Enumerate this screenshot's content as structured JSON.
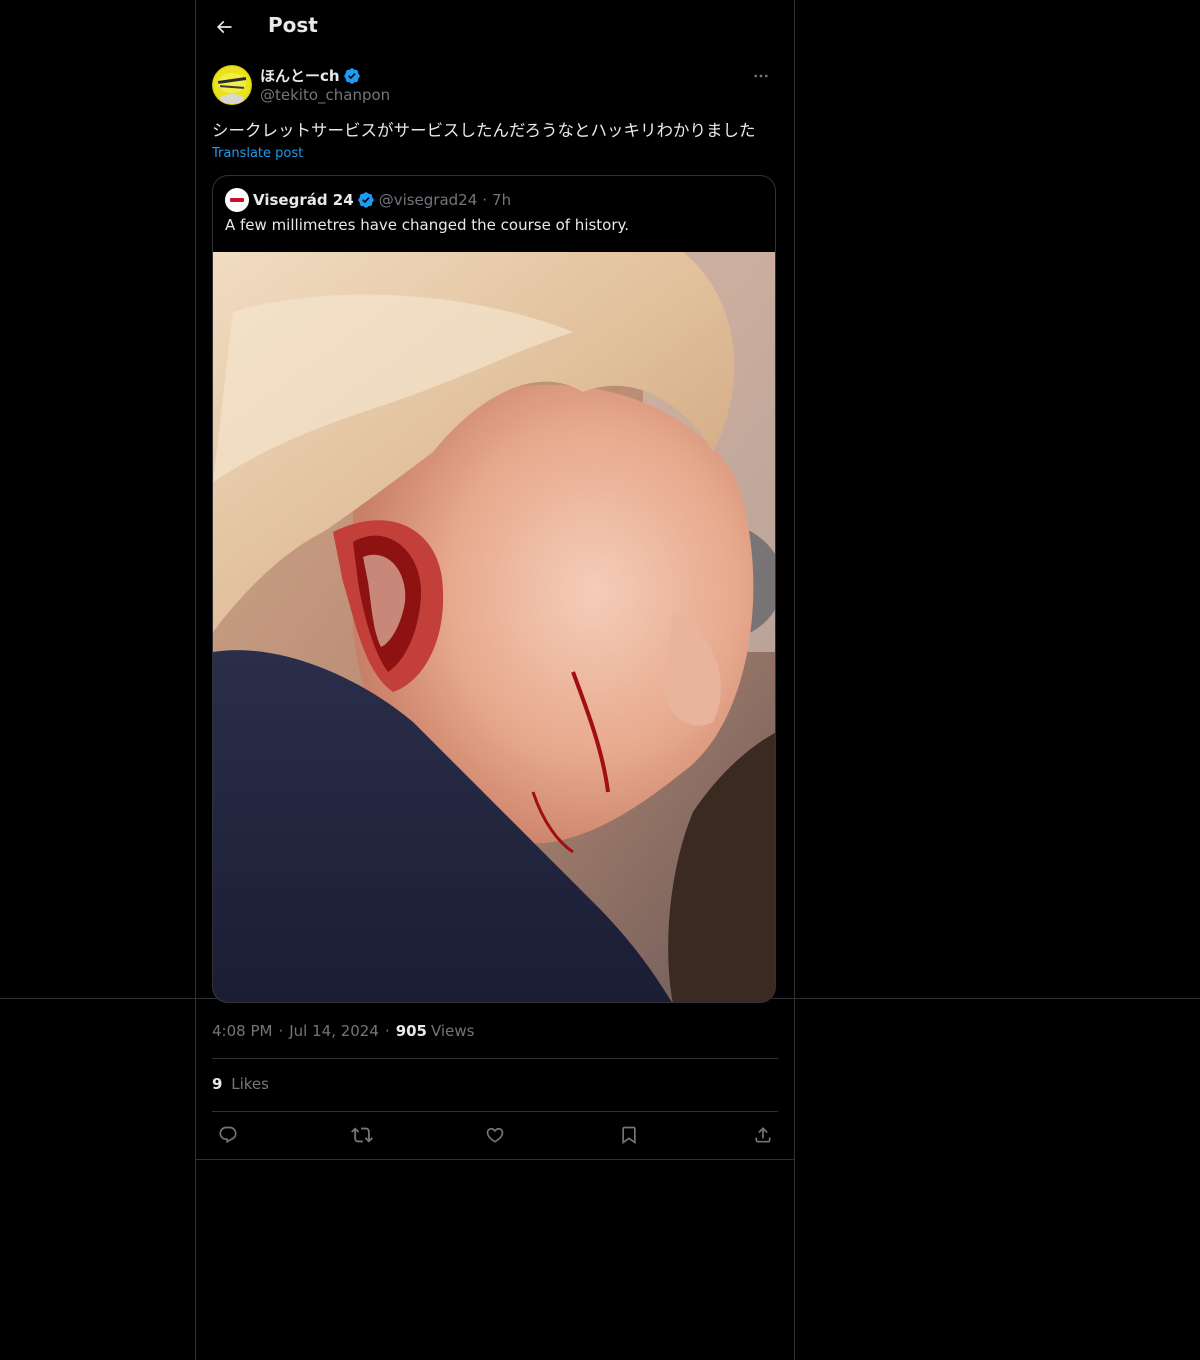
{
  "header": {
    "title": "Post"
  },
  "post": {
    "author_name": "ほんとーch",
    "author_handle": "@tekito_chanpon",
    "text": "シークレットサービスがサービスしたんだろうなとハッキリわかりました",
    "translate_label": "Translate post",
    "time": "4:08 PM",
    "date": "Jul 14, 2024",
    "views_count": "905",
    "views_label": "Views",
    "likes_count": "9",
    "likes_label": "Likes"
  },
  "quote": {
    "name": "Visegrád 24",
    "handle": "@visegrad24",
    "time": "7h",
    "text": "A few millimetres have changed the course of history."
  },
  "icons": {
    "back": "arrow-left-icon",
    "verified": "verified-badge-icon",
    "more": "more-horizontal-icon",
    "reply": "reply-icon",
    "repost": "repost-icon",
    "like": "heart-icon",
    "bookmark": "bookmark-icon",
    "share": "share-icon"
  },
  "colors": {
    "background": "#000000",
    "border": "#2f3336",
    "text": "#e7e9ea",
    "muted": "#71767b",
    "accent": "#1d9bf0"
  }
}
